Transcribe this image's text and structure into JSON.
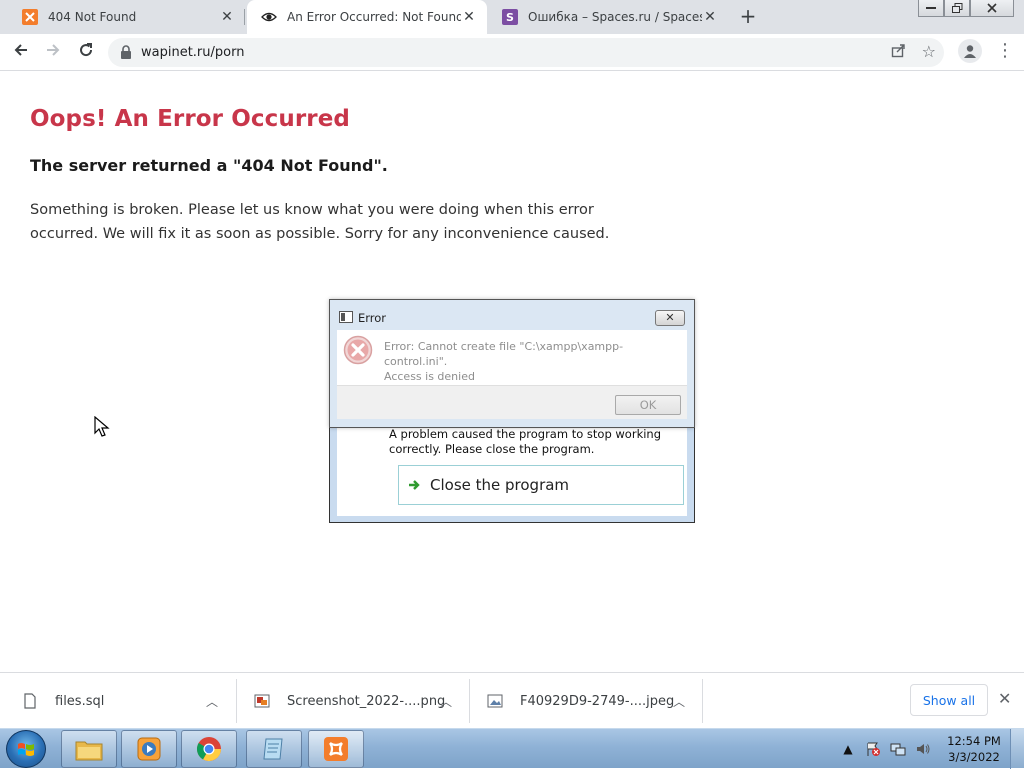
{
  "tabs": [
    {
      "title": "404 Not Found",
      "icon": "xampp-icon"
    },
    {
      "title": "An Error Occurred: Not Found",
      "icon": "eye-icon"
    },
    {
      "title": "Ошибка – Spaces.ru / Spaces.im",
      "icon": "spaces-icon"
    }
  ],
  "address_bar": {
    "url": "wapinet.ru/porn"
  },
  "page": {
    "heading": "Oops! An Error Occurred",
    "subheading": "The server returned a \"404 Not Found\".",
    "line1": "Something is broken. Please let us know what you were doing when this error",
    "line2": "occurred. We will fix it as soon as possible. Sorry for any inconvenience caused."
  },
  "error_dialog": {
    "title": "Error",
    "close_glyph": "✕",
    "message_line1": "Error: Cannot create file \"C:\\xampp\\xampp-control.ini\".",
    "message_line2": "Access is denied",
    "ok_label": "OK"
  },
  "crash_dialog": {
    "message_line1": "A problem caused the program to stop working",
    "message_line2": "correctly. Please close the program.",
    "close_button_label": "Close the program"
  },
  "downloads": [
    {
      "name": "files.sql",
      "icon": "file-icon"
    },
    {
      "name": "Screenshot_2022-....png",
      "icon": "image-icon"
    },
    {
      "name": "F40929D9-2749-....jpeg",
      "icon": "image-icon"
    }
  ],
  "download_shelf": {
    "show_all_label": "Show all"
  },
  "taskbar": {
    "apps": [
      "explorer-icon",
      "media-player-icon",
      "chrome-icon",
      "notepad-icon",
      "xampp-icon"
    ],
    "clock": {
      "time": "12:54 PM",
      "date": "3/3/2022"
    }
  },
  "colors": {
    "heading": "#c8364a",
    "link": "#1a73e8",
    "tabstrip": "#dee1e6"
  }
}
